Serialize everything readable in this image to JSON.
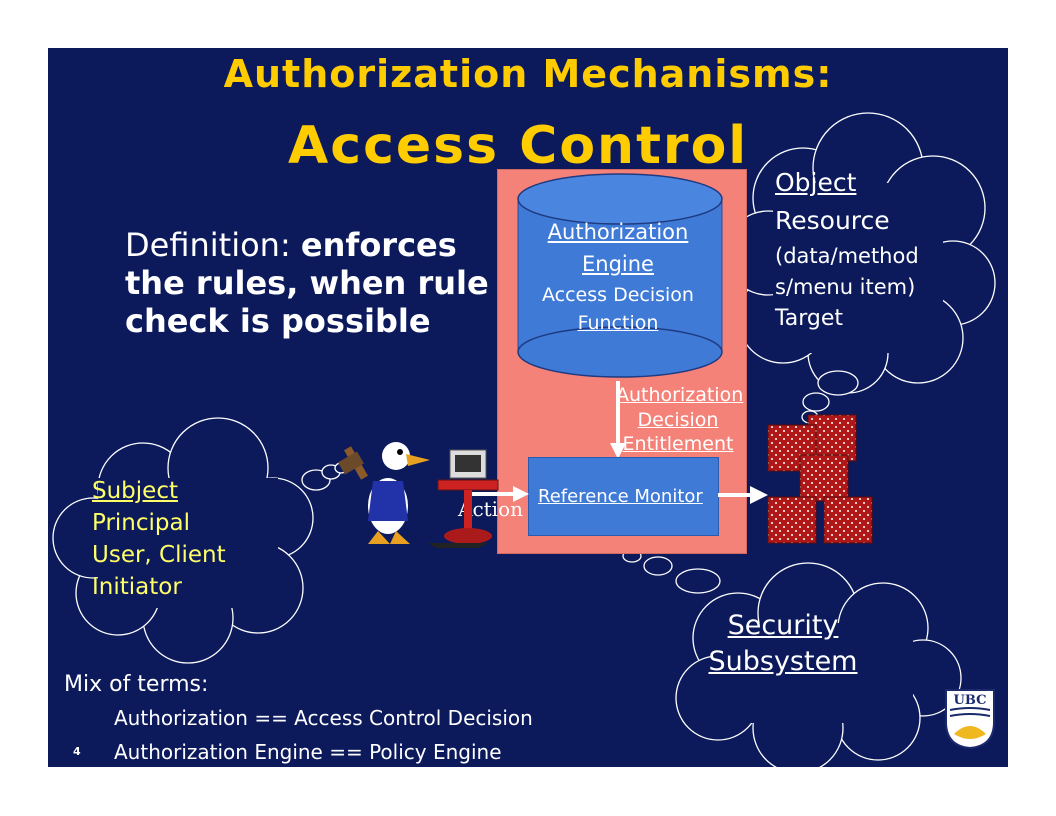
{
  "slide": {
    "title_line1": "Authorization Mechanisms:",
    "title_line2": "Access Control",
    "definition": {
      "lead": "Definition: ",
      "bold": "enforces the rules, when rule check is possible"
    },
    "engine": {
      "title_line1": "Authorization",
      "title_line2": "Engine",
      "sub_line1": "Access Decision",
      "sub_line2": "Function"
    },
    "decision": {
      "line1": "Authorization",
      "line2": "Decision",
      "line3": "Entitlement"
    },
    "reference_monitor": "Reference Monitor",
    "action": "Action",
    "object_cloud": {
      "title": "Object",
      "line1": "Resource",
      "line2": "(data/method",
      "line3": "s/menu item)",
      "line4": "Target"
    },
    "subject_cloud": {
      "title": "Subject",
      "line1": "Principal",
      "line2": "User, Client",
      "line3": "Initiator"
    },
    "security_cloud": {
      "line1": "Security",
      "line2": "Subsystem"
    },
    "mix_terms": {
      "heading": "Mix of terms:",
      "line1": "Authorization == Access Control Decision",
      "line2": "Authorization Engine == Policy Engine"
    },
    "page_number": "4",
    "logo_text": "UBC"
  },
  "colors": {
    "background": "#0c1a5c",
    "title": "#ffcc00",
    "subject_text": "#ffff66",
    "box": "#f58279",
    "cylinder": "#3e7ad6",
    "resource": "#b01818"
  },
  "icons": {
    "user_figure": "duck-character-icon",
    "terminal": "computer-terminal-icon",
    "resources": "resource-cubes-icon",
    "logo": "ubc-crest-icon"
  }
}
